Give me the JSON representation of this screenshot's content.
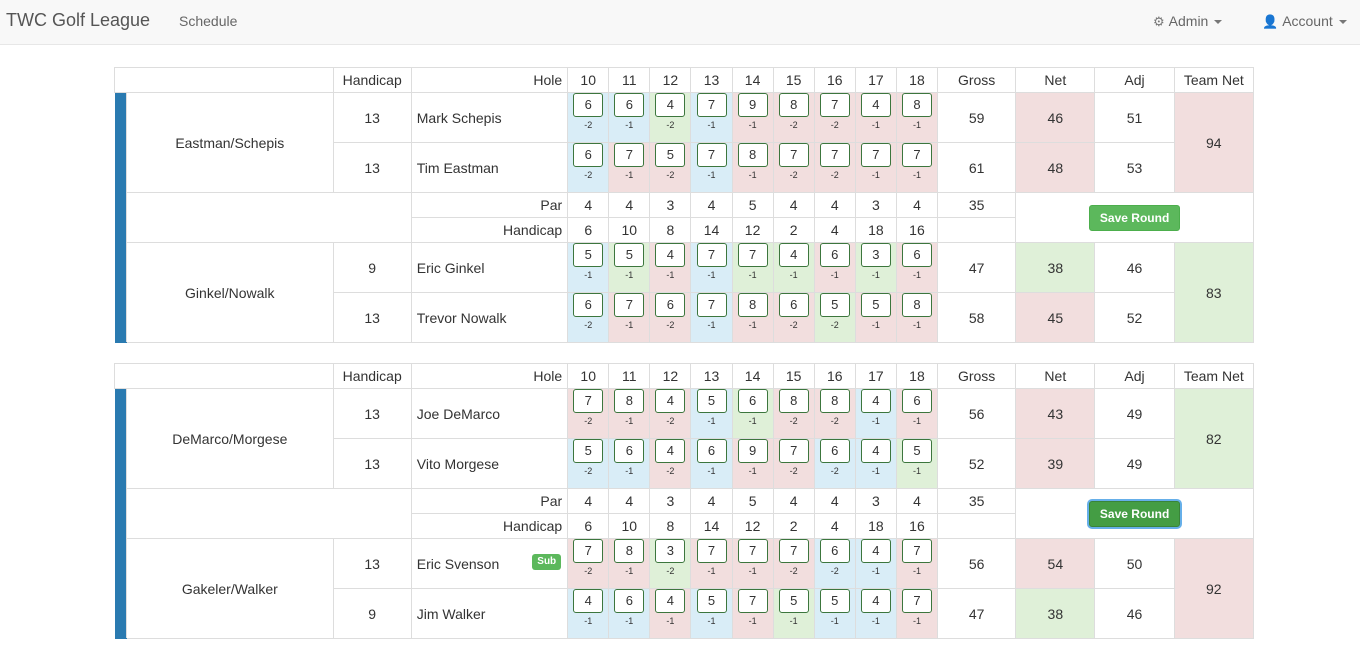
{
  "nav": {
    "brand": "TWC Golf League",
    "schedule": "Schedule",
    "admin": "Admin",
    "account": "Account",
    "admin_icon": "gears-icon",
    "account_icon": "user-icon"
  },
  "colors": {
    "blue": "#d9edf7",
    "green": "#dff0d8",
    "red": "#f2dede",
    "bar": "#2a7ab0",
    "button": "#5cb85c"
  },
  "headers": {
    "handicap": "Handicap",
    "hole": "Hole",
    "holes": [
      "10",
      "11",
      "12",
      "13",
      "14",
      "15",
      "16",
      "17",
      "18"
    ],
    "gross": "Gross",
    "net": "Net",
    "adj": "Adj",
    "team_net": "Team Net",
    "par_label": "Par",
    "hcp_label": "Handicap",
    "save_label": "Save Round",
    "sub_label": "Sub"
  },
  "matches": [
    {
      "par": [
        "4",
        "4",
        "3",
        "4",
        "5",
        "4",
        "4",
        "3",
        "4"
      ],
      "par_total": "35",
      "hole_hcp": [
        "6",
        "10",
        "8",
        "14",
        "12",
        "2",
        "4",
        "18",
        "16"
      ],
      "teams": [
        {
          "name": "Eastman/Schepis",
          "team_net": "94",
          "team_net_color": "red",
          "players": [
            {
              "name": "Mark Schepis",
              "hcp": "13",
              "sub": false,
              "scores": [
                "6",
                "6",
                "4",
                "7",
                "9",
                "8",
                "7",
                "4",
                "8"
              ],
              "diffs": [
                "-2",
                "-1",
                "-2",
                "-1",
                "-1",
                "-2",
                "-2",
                "-1",
                "-1"
              ],
              "colors": [
                "blue",
                "blue",
                "green",
                "blue",
                "red",
                "red",
                "red",
                "red",
                "red"
              ],
              "gross": "59",
              "net": "46",
              "net_color": "red",
              "adj": "51"
            },
            {
              "name": "Tim Eastman",
              "hcp": "13",
              "sub": false,
              "scores": [
                "6",
                "7",
                "5",
                "7",
                "8",
                "7",
                "7",
                "7",
                "7"
              ],
              "diffs": [
                "-2",
                "-1",
                "-2",
                "-1",
                "-1",
                "-2",
                "-2",
                "-1",
                "-1"
              ],
              "colors": [
                "blue",
                "red",
                "red",
                "blue",
                "red",
                "red",
                "red",
                "red",
                "red"
              ],
              "gross": "61",
              "net": "48",
              "net_color": "red",
              "adj": "53"
            }
          ]
        },
        {
          "name": "Ginkel/Nowalk",
          "team_net": "83",
          "team_net_color": "green",
          "players": [
            {
              "name": "Eric Ginkel",
              "hcp": "9",
              "sub": false,
              "scores": [
                "5",
                "5",
                "4",
                "7",
                "7",
                "4",
                "6",
                "3",
                "6"
              ],
              "diffs": [
                "-1",
                "-1",
                "-1",
                "-1",
                "-1",
                "-1",
                "-1",
                "-1",
                "-1"
              ],
              "colors": [
                "blue",
                "green",
                "red",
                "blue",
                "green",
                "green",
                "red",
                "green",
                "red"
              ],
              "gross": "47",
              "net": "38",
              "net_color": "green",
              "adj": "46"
            },
            {
              "name": "Trevor Nowalk",
              "hcp": "13",
              "sub": false,
              "scores": [
                "6",
                "7",
                "6",
                "7",
                "8",
                "6",
                "5",
                "5",
                "8"
              ],
              "diffs": [
                "-2",
                "-1",
                "-2",
                "-1",
                "-1",
                "-2",
                "-2",
                "-1",
                "-1"
              ],
              "colors": [
                "blue",
                "red",
                "red",
                "blue",
                "red",
                "red",
                "green",
                "red",
                "red"
              ],
              "gross": "58",
              "net": "45",
              "net_color": "red",
              "adj": "52"
            }
          ]
        }
      ]
    },
    {
      "par": [
        "4",
        "4",
        "3",
        "4",
        "5",
        "4",
        "4",
        "3",
        "4"
      ],
      "par_total": "35",
      "hole_hcp": [
        "6",
        "10",
        "8",
        "14",
        "12",
        "2",
        "4",
        "18",
        "16"
      ],
      "teams": [
        {
          "name": "DeMarco/Morgese",
          "team_net": "82",
          "team_net_color": "green",
          "players": [
            {
              "name": "Joe DeMarco",
              "hcp": "13",
              "sub": false,
              "scores": [
                "7",
                "8",
                "4",
                "5",
                "6",
                "8",
                "8",
                "4",
                "6"
              ],
              "diffs": [
                "-2",
                "-1",
                "-2",
                "-1",
                "-1",
                "-2",
                "-2",
                "-1",
                "-1"
              ],
              "colors": [
                "red",
                "red",
                "red",
                "blue",
                "green",
                "red",
                "red",
                "blue",
                "red"
              ],
              "gross": "56",
              "net": "43",
              "net_color": "red",
              "adj": "49"
            },
            {
              "name": "Vito Morgese",
              "hcp": "13",
              "sub": false,
              "scores": [
                "5",
                "6",
                "4",
                "6",
                "9",
                "7",
                "6",
                "4",
                "5"
              ],
              "diffs": [
                "-2",
                "-1",
                "-2",
                "-1",
                "-1",
                "-2",
                "-2",
                "-1",
                "-1"
              ],
              "colors": [
                "blue",
                "blue",
                "red",
                "blue",
                "red",
                "red",
                "blue",
                "blue",
                "green"
              ],
              "gross": "52",
              "net": "39",
              "net_color": "red",
              "adj": "49"
            }
          ]
        },
        {
          "name": "Gakeler/Walker",
          "team_net": "92",
          "team_net_color": "red",
          "players": [
            {
              "name": "Eric Svenson",
              "hcp": "13",
              "sub": true,
              "scores": [
                "7",
                "8",
                "3",
                "7",
                "7",
                "7",
                "6",
                "4",
                "7"
              ],
              "diffs": [
                "-2",
                "-1",
                "-2",
                "-1",
                "-1",
                "-2",
                "-2",
                "-1",
                "-1"
              ],
              "colors": [
                "red",
                "red",
                "green",
                "red",
                "red",
                "red",
                "blue",
                "blue",
                "red"
              ],
              "gross": "56",
              "net": "54",
              "net_color": "red",
              "adj": "50"
            },
            {
              "name": "Jim Walker",
              "hcp": "9",
              "sub": false,
              "scores": [
                "4",
                "6",
                "4",
                "5",
                "7",
                "5",
                "5",
                "4",
                "7"
              ],
              "diffs": [
                "-1",
                "-1",
                "-1",
                "-1",
                "-1",
                "-1",
                "-1",
                "-1",
                "-1"
              ],
              "colors": [
                "blue",
                "blue",
                "red",
                "blue",
                "red",
                "green",
                "blue",
                "blue",
                "red"
              ],
              "gross": "47",
              "net": "38",
              "net_color": "green",
              "adj": "46"
            }
          ]
        }
      ]
    }
  ]
}
